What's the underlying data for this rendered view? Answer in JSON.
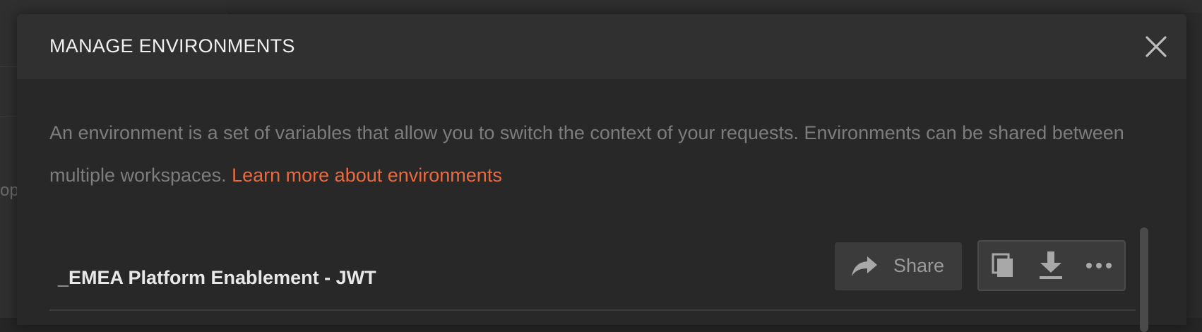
{
  "background": {
    "partial_text": "op"
  },
  "modal": {
    "title": "MANAGE ENVIRONMENTS",
    "description": "An environment is a set of variables that allow you to switch the context of your requests. Environments can be shared between multiple workspaces.",
    "learn_more_label": "Learn more about environments"
  },
  "environment": {
    "name": "_EMEA Platform Enablement - JWT",
    "share_label": "Share",
    "actions": {
      "duplicate_icon": "duplicate-icon",
      "download_icon": "download-icon",
      "more_icon": "more-icon"
    }
  },
  "colors": {
    "accent": "#ea6a3f",
    "modal_bg": "#282828",
    "header_bg": "#303030",
    "button_bg": "#3b3b3b"
  }
}
